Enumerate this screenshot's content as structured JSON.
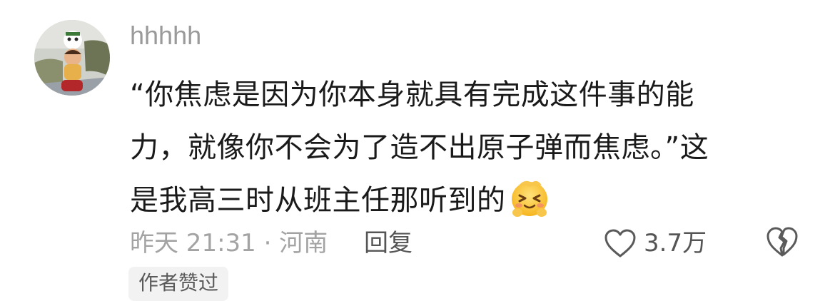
{
  "comment": {
    "username": "hhhhh",
    "content_lines": [
      "“你焦虑是因为你本身就具有完成这件事的能",
      "力，就像你不会为了造不出原子弹而焦虑。”这",
      "是我高三时从班主任那听到的"
    ],
    "emoji_icon": "grinning-squinting-face-emoji",
    "time_location": "昨天 21:31 · 河南",
    "reply_label": "回复",
    "like_count": "3.7万",
    "badge": "作者赞过",
    "colors": {
      "text": "#1a1a1a",
      "meta": "#a3a3a3",
      "badge_bg": "#f2f2f2"
    }
  }
}
